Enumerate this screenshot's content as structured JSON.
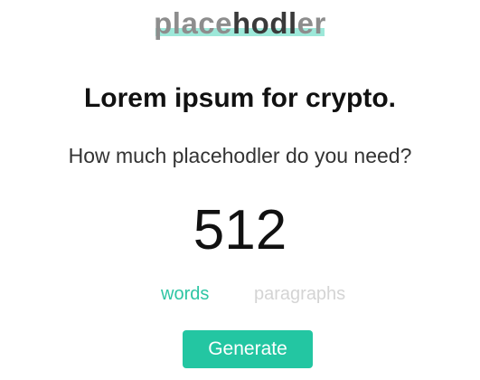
{
  "header": {
    "logo_light": "place",
    "logo_dark": "hodl",
    "logo_light_end": "er",
    "accent_underline_color": "#9de8d9"
  },
  "main": {
    "headline": "Lorem ipsum for crypto.",
    "question": "How much placehodler do you need?",
    "count": "512",
    "units": {
      "options": [
        "words",
        "paragraphs"
      ],
      "selected": "words",
      "words_label": "words",
      "paragraphs_label": "paragraphs"
    },
    "generate_label": "Generate"
  },
  "colors": {
    "accent": "#23c6a2",
    "selected_unit": "#2dc5a3",
    "inactive_unit": "#d4d4d4"
  }
}
